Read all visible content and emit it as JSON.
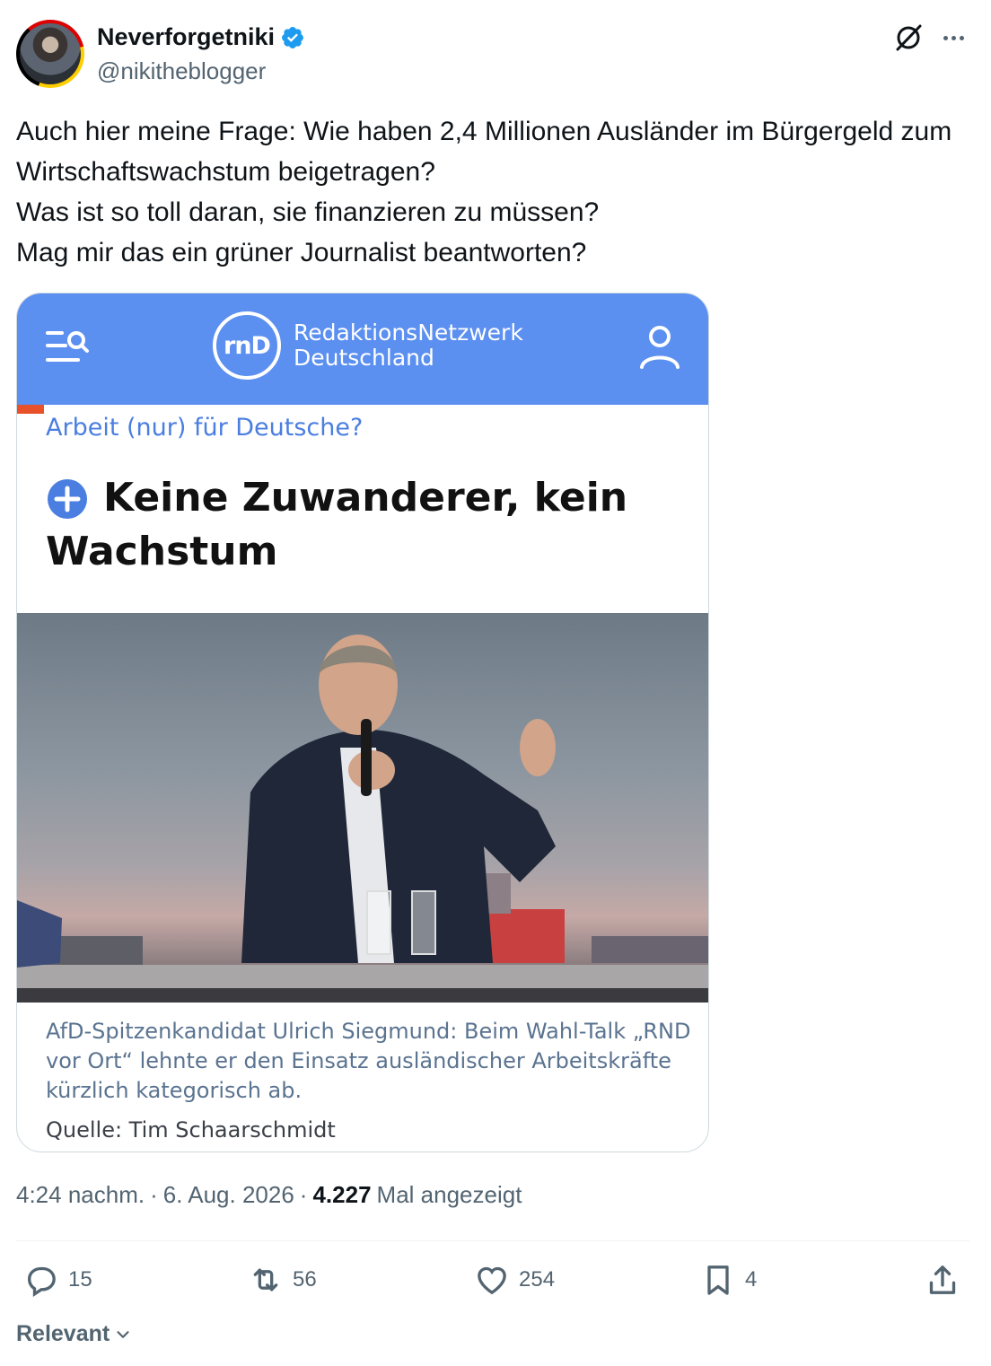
{
  "author": {
    "display_name": "Neverforgetniki",
    "handle": "@nikitheblogger",
    "verified": true
  },
  "tweet": {
    "text": "Auch hier meine Frage: Wie haben 2,4 Millionen Ausländer im Bürgergeld zum Wirtschaftswachstum beigetragen?\nWas ist so toll daran, sie finanzieren zu müssen?\nMag mir das ein grüner Journalist beantworten?"
  },
  "media": {
    "logo_text": "rnD",
    "brand_line1": "RedaktionsNetzwerk",
    "brand_line2": "Deutschland",
    "kicker": "Arbeit (nur) für Deutsche?",
    "headline": "Keine Zuwanderer, kein Wachstum",
    "caption": "AfD-Spitzenkandidat Ulrich Siegmund: Beim Wahl-Talk „RND vor Ort“ lehnte er den Einsatz ausländischer Arbeitskräfte kürzlich kategorisch ab.",
    "source": "Quelle: Tim Schaarschmidt"
  },
  "meta": {
    "time": "4:24 nachm.",
    "sep1": "·",
    "date": "6. Aug. 2026",
    "sep2": "·",
    "views": "4.227",
    "views_label": "Mal angezeigt"
  },
  "actions": {
    "replies": "15",
    "reposts": "56",
    "likes": "254",
    "bookmarks": "4"
  },
  "sort": {
    "label": "Relevant"
  },
  "colors": {
    "rnd_blue": "#5b8ff0",
    "verified_blue": "#1d9bf0",
    "muted": "#536471"
  }
}
